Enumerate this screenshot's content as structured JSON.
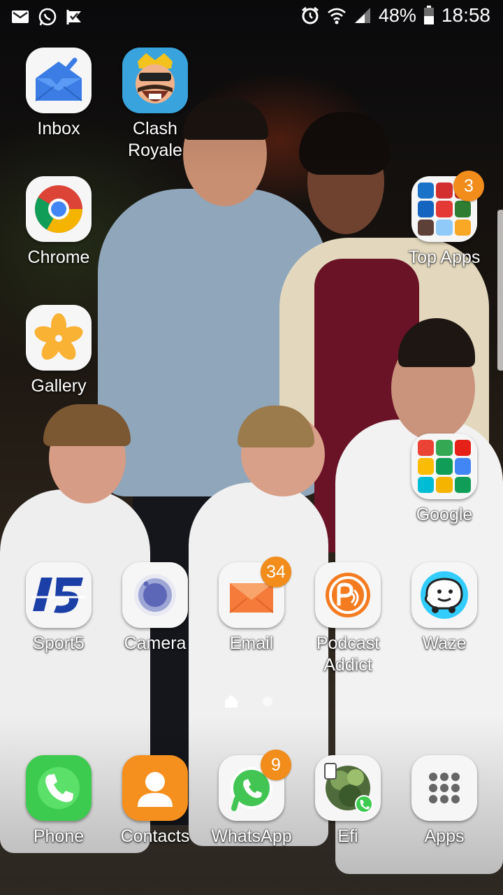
{
  "status_bar": {
    "left_icons": [
      "mail-icon",
      "whatsapp-icon",
      "check-flag-icon"
    ],
    "right_icons": [
      "alarm-icon",
      "wifi-icon",
      "signal-icon",
      "battery-icon"
    ],
    "battery": "48%",
    "time": "18:58"
  },
  "home": {
    "apps": {
      "inbox": {
        "label": "Inbox",
        "icon": "inbox-icon"
      },
      "clash_royale": {
        "label": "Clash\nRoyale",
        "icon": "clash-royale-icon"
      },
      "chrome": {
        "label": "Chrome",
        "icon": "chrome-icon"
      },
      "top_apps": {
        "label": "Top Apps",
        "icon": "folder-icon",
        "badge": "3"
      },
      "gallery": {
        "label": "Gallery",
        "icon": "gallery-flower-icon"
      },
      "google": {
        "label": "Google",
        "icon": "folder-icon"
      },
      "sport5": {
        "label": "Sport5",
        "icon": "sport5-icon"
      },
      "camera": {
        "label": "Camera",
        "icon": "camera-icon"
      },
      "email": {
        "label": "Email",
        "icon": "email-envelope-icon",
        "badge": "34"
      },
      "podcast_addict": {
        "label": "Podcast\nAddict",
        "icon": "podcast-addict-icon"
      },
      "waze": {
        "label": "Waze",
        "icon": "waze-icon"
      }
    }
  },
  "dock": {
    "phone": {
      "label": "Phone",
      "icon": "phone-icon"
    },
    "contacts": {
      "label": "Contacts",
      "icon": "contacts-icon"
    },
    "whatsapp": {
      "label": "WhatsApp",
      "icon": "whatsapp-icon",
      "badge": "9"
    },
    "efi": {
      "label": "Efi",
      "icon": "contact-shortcut-icon"
    },
    "apps": {
      "label": "Apps",
      "icon": "apps-grid-icon"
    }
  },
  "colors": {
    "badge": "#f28c1a",
    "label_text": "#ffffff"
  }
}
